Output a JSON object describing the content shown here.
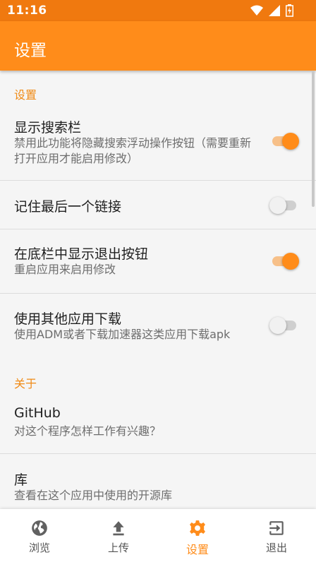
{
  "status_bar": {
    "time": "11:16",
    "icons": [
      "wifi-icon",
      "signal-icon",
      "battery-charging-icon"
    ]
  },
  "app_bar": {
    "title": "设置"
  },
  "sections": {
    "settings_header": "设置",
    "about_header": "关于"
  },
  "items": {
    "search_bar": {
      "title": "显示搜索栏",
      "summary": "禁用此功能将隐藏搜索浮动操作按钮（需要重新打开应用才能启用修改）",
      "enabled": true
    },
    "remember_link": {
      "title": "记住最后一个链接",
      "enabled": false
    },
    "exit_button": {
      "title": "在底栏中显示退出按钮",
      "summary": "重启应用来启用修改",
      "enabled": true
    },
    "other_app": {
      "title": "使用其他应用下载",
      "summary": "使用ADM或者下载加速器这类应用下载apk",
      "enabled": false
    },
    "github": {
      "title": "GitHub",
      "summary": "对这个程序怎样工作有兴趣？"
    },
    "libraries": {
      "title": "库",
      "summary": "查看在这个应用中使用的开源库"
    }
  },
  "bottom_nav": [
    {
      "label": "浏览",
      "icon": "globe-icon",
      "active": false
    },
    {
      "label": "上传",
      "icon": "upload-icon",
      "active": false
    },
    {
      "label": "设置",
      "icon": "gear-icon",
      "active": true
    },
    {
      "label": "退出",
      "icon": "exit-icon",
      "active": false
    }
  ],
  "colors": {
    "accent": "#ff8c1a",
    "status_bar": "#f0790f",
    "section_header": "#f08a15"
  }
}
